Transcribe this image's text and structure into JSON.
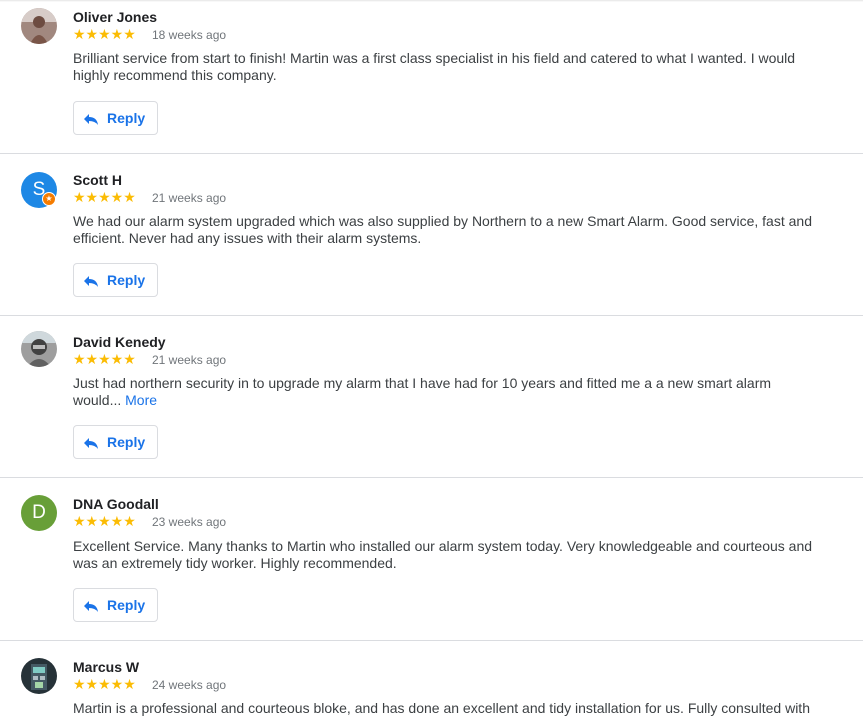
{
  "colors": {
    "star": "#fbbc04",
    "link": "#1a73e8",
    "divider": "#dadce0"
  },
  "reviews": [
    {
      "name": "Oliver Jones",
      "stars": "★★★★★",
      "rating": 5,
      "time": "18 weeks ago",
      "text": "Brilliant service from start to finish! Martin was a first class specialist in his field and catered to what I wanted. I would highly recommend this company.",
      "more": "",
      "reply": "Reply",
      "avatar": {
        "type": "photo",
        "color": "#8d6e63",
        "icon": "profile-photo"
      }
    },
    {
      "name": "Scott H",
      "stars": "★★★★★",
      "rating": 5,
      "time": "21 weeks ago",
      "text": "We had our alarm system upgraded which was also supplied by Northern to a new Smart Alarm. Good service, fast and efficient. Never had any issues with their alarm systems.",
      "more": "",
      "reply": "Reply",
      "avatar": {
        "type": "letter",
        "letter": "S",
        "color": "#1e88e5",
        "badge": "local-guide-icon"
      }
    },
    {
      "name": "David Kenedy",
      "stars": "★★★★★",
      "rating": 5,
      "time": "21 weeks ago",
      "text": "Just had northern security in to upgrade my alarm that I have had for 10 years and fitted me a a new smart alarm would...",
      "more": "More",
      "reply": "Reply",
      "avatar": {
        "type": "photo",
        "color": "#6b6b6b",
        "icon": "profile-photo"
      }
    },
    {
      "name": "DNA Goodall",
      "stars": "★★★★★",
      "rating": 5,
      "time": "23 weeks ago",
      "text": "Excellent Service. Many thanks to Martin who installed our alarm system today. Very knowledgeable and courteous and was an extremely tidy worker. Highly recommended.",
      "more": "",
      "reply": "Reply",
      "avatar": {
        "type": "letter",
        "letter": "D",
        "color": "#689f38"
      }
    },
    {
      "name": "Marcus W",
      "stars": "★★★★★",
      "rating": 5,
      "time": "24 weeks ago",
      "text": "Martin is a professional and courteous bloke, and has done an excellent and tidy installation for us. Fully consulted with",
      "more": "",
      "reply": "Reply",
      "avatar": {
        "type": "photo",
        "color": "#37474f",
        "icon": "profile-photo"
      }
    }
  ]
}
